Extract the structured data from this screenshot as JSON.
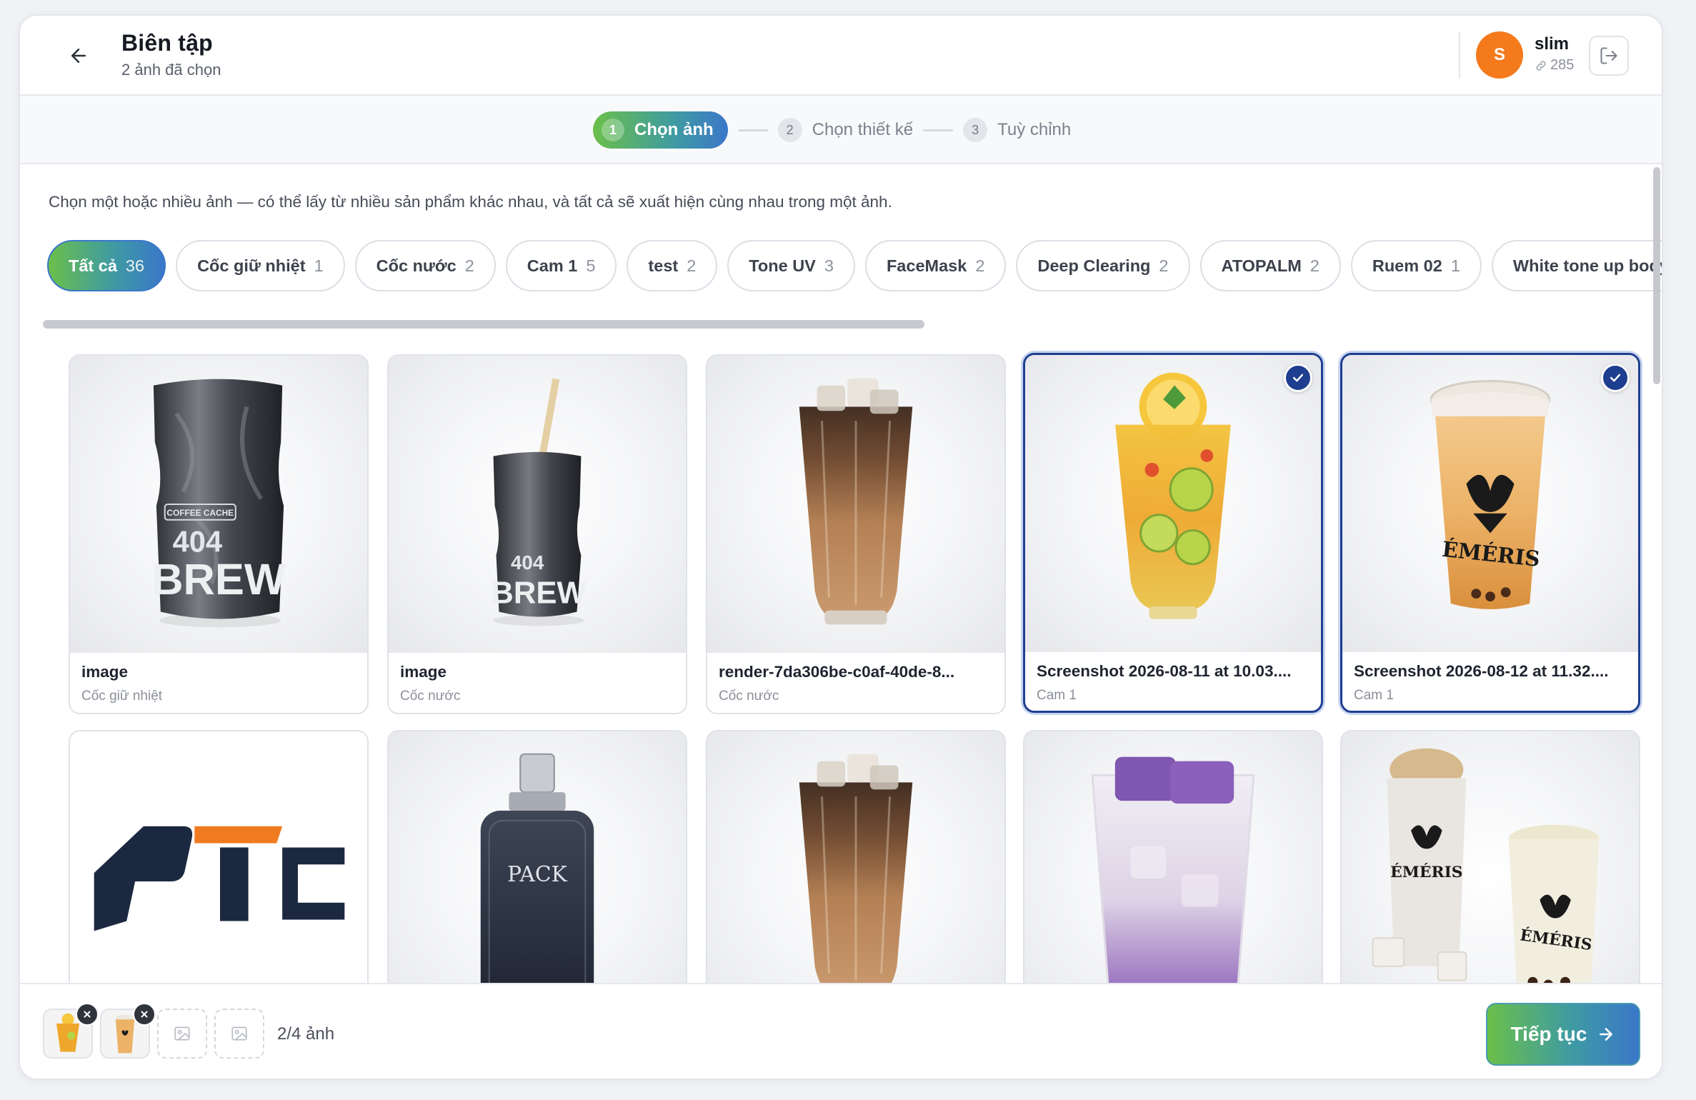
{
  "header": {
    "title": "Biên tập",
    "subtitle": "2 ảnh đã chọn",
    "user": {
      "initial": "S",
      "name": "slim",
      "credits": "285",
      "avatar_color": "#f47a1c"
    }
  },
  "stepper": {
    "steps": [
      {
        "num": "1",
        "label": "Chọn ảnh",
        "active": true
      },
      {
        "num": "2",
        "label": "Chọn thiết kế",
        "active": false
      },
      {
        "num": "3",
        "label": "Tuỳ chỉnh",
        "active": false
      }
    ]
  },
  "instruction": "Chọn một hoặc nhiều ảnh — có thể lấy từ nhiều sản phẩm khác nhau, và tất cả sẽ xuất hiện cùng nhau trong một ảnh.",
  "filters": [
    {
      "label": "Tất cả",
      "count": "36",
      "active": true
    },
    {
      "label": "Cốc giữ nhiệt",
      "count": "1"
    },
    {
      "label": "Cốc nước",
      "count": "2"
    },
    {
      "label": "Cam 1",
      "count": "5"
    },
    {
      "label": "test",
      "count": "2"
    },
    {
      "label": "Tone UV",
      "count": "3"
    },
    {
      "label": "FaceMask",
      "count": "2"
    },
    {
      "label": "Deep Clearing",
      "count": "2"
    },
    {
      "label": "ATOPALM",
      "count": "2"
    },
    {
      "label": "Ruem 02",
      "count": "1"
    },
    {
      "label": "White tone up body",
      "count": ""
    }
  ],
  "images": [
    {
      "title": "image",
      "category": "Cốc giữ nhiệt",
      "selected": false,
      "art": "tumbler-dark"
    },
    {
      "title": "image",
      "category": "Cốc nước",
      "selected": false,
      "art": "tumbler-straw"
    },
    {
      "title": "render-7da306be-c0af-40de-8...",
      "category": "Cốc nước",
      "selected": false,
      "art": "iced-coffee"
    },
    {
      "title": "Screenshot 2026-08-11 at 10.03....",
      "category": "Cam 1",
      "selected": true,
      "art": "fruit-tea"
    },
    {
      "title": "Screenshot 2026-08-12 at 11.32....",
      "category": "Cam 1",
      "selected": true,
      "art": "milk-tea-cup"
    },
    {
      "title": "",
      "category": "",
      "selected": false,
      "art": "ptc-logo",
      "logo_text": "PTC"
    },
    {
      "title": "",
      "category": "",
      "selected": false,
      "art": "perfume",
      "label_text": "PACK"
    },
    {
      "title": "",
      "category": "",
      "selected": false,
      "art": "iced-coffee"
    },
    {
      "title": "",
      "category": "",
      "selected": false,
      "art": "taro-drink"
    },
    {
      "title": "",
      "category": "",
      "selected": false,
      "art": "milk-tea-duo"
    }
  ],
  "footer": {
    "count_label": "2/4 ảnh",
    "continue_label": "Tiếp tục"
  },
  "colors": {
    "accent_gradient_start": "#6bbf4a",
    "accent_gradient_end": "#3a77c9",
    "selected_border": "#1e3e8f"
  }
}
